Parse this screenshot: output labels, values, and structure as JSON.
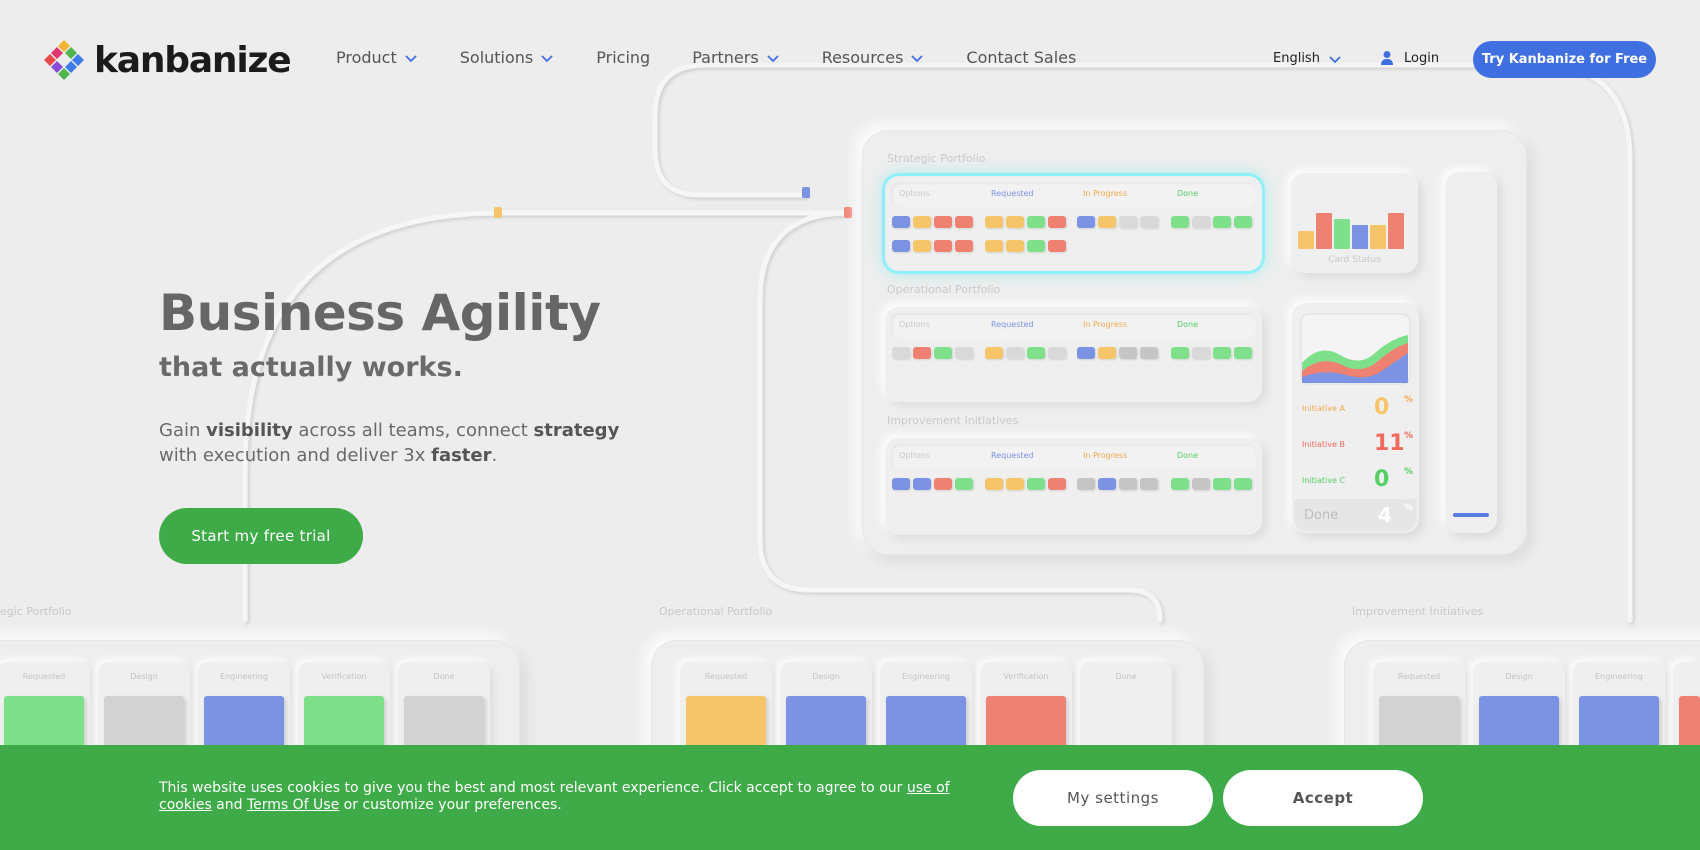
{
  "brand": {
    "name": "kanbanize"
  },
  "nav": {
    "items": [
      {
        "label": "Product",
        "has_dropdown": true
      },
      {
        "label": "Solutions",
        "has_dropdown": true
      },
      {
        "label": "Pricing",
        "has_dropdown": false
      },
      {
        "label": "Partners",
        "has_dropdown": true
      },
      {
        "label": "Resources",
        "has_dropdown": true
      },
      {
        "label": "Contact Sales",
        "has_dropdown": false
      }
    ],
    "language": "English",
    "login": "Login",
    "try_button": "Try Kanbanize for Free"
  },
  "hero": {
    "title": "Business Agility",
    "subtitle": "that actually works.",
    "desc_1": "Gain ",
    "desc_bold_1": "visibility",
    "desc_2": " across all teams, connect ",
    "desc_bold_2": "strategy",
    "desc_3": " with execution and deliver 3x ",
    "desc_bold_3": "faster",
    "desc_4": ".",
    "cta": "Start my free trial"
  },
  "illustration": {
    "portfolios": [
      "Strategic Portfolio",
      "Operational Portfolio",
      "Improvement Initiatives"
    ],
    "columns": [
      "Options",
      "Requested",
      "In Progress",
      "Done"
    ],
    "card_status_label": "Card Status",
    "initiatives": [
      {
        "label": "Initiative A",
        "value": "0",
        "unit": "%"
      },
      {
        "label": "Initiative B",
        "value": "11",
        "unit": "%"
      },
      {
        "label": "Initiative C",
        "value": "0",
        "unit": "%"
      }
    ],
    "done": {
      "label": "Done",
      "value": "4",
      "unit": "%"
    },
    "bottom_portfolios": [
      "egic Portfolio",
      "Operational Portfolio",
      "Improvement Initiatives"
    ],
    "bottom_columns": [
      "Requested",
      "Design",
      "Engineering",
      "Verification",
      "Done"
    ],
    "colors": {
      "blue": "#7b93e2",
      "yellow": "#f6c56a",
      "red": "#ef8172",
      "green": "#7ee08b",
      "gray": "#d2d2d2",
      "accent_blue": "#3f6fe0",
      "brand_green": "#3eab48"
    }
  },
  "cookie": {
    "text_1": "This website uses cookies to give you the best and most relevant experience. Click accept to agree to our ",
    "link_1": "use of cookies",
    "text_2": " and ",
    "link_2": "Terms Of Use",
    "text_3": " or customize your preferences.",
    "settings_button": "My settings",
    "accept_button": "Accept"
  }
}
